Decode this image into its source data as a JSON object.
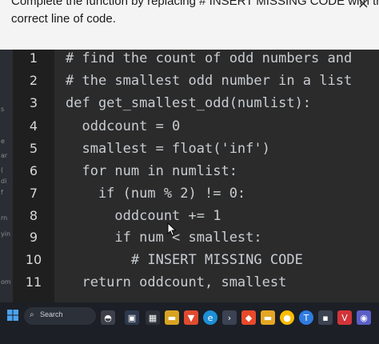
{
  "prompt": {
    "line1": "Complete the function by replacing # INSERT MISSING CODE with the",
    "line2": "correct line of code.",
    "close": "×"
  },
  "sidebar_fragments": [
    "s",
    "e",
    "ar",
    "(",
    "di",
    "f",
    "rn",
    "yin",
    "om"
  ],
  "code": {
    "lines": [
      {
        "num": "1",
        "text": "# find the count of odd numbers and"
      },
      {
        "num": "2",
        "text": "# the smallest odd number in a list"
      },
      {
        "num": "3",
        "text": "def get_smallest_odd(numlist):"
      },
      {
        "num": "4",
        "text": "  oddcount = 0"
      },
      {
        "num": "5",
        "text": "  smallest = float('inf')"
      },
      {
        "num": "6",
        "text": "  for num in numlist:"
      },
      {
        "num": "7",
        "text": "    if (num % 2) != 0:"
      },
      {
        "num": "8",
        "text": "      oddcount += 1"
      },
      {
        "num": "9",
        "text": "      if num < smallest:"
      },
      {
        "num": "10",
        "text": "        # INSERT MISSING CODE"
      },
      {
        "num": "11",
        "text": "  return oddcount, smallest"
      }
    ]
  },
  "taskbar": {
    "search_label": "Search",
    "icons": [
      "windows-start-icon",
      "search-icon",
      "copilot-icon",
      "task-view-icon",
      "widgets-icon",
      "file-explorer-icon",
      "store-icon",
      "brave-browser-icon",
      "edge-browser-icon",
      "terminal-icon",
      "app-icon",
      "chrome-browser-icon",
      "onedrive-icon",
      "firefox-icon",
      "vivaldi-icon",
      "teams-icon"
    ]
  },
  "colors": {
    "editor_bg": "#2b2b2b",
    "gutter_bg": "#1f1f1f",
    "code_text": "#c9cdd2",
    "taskbar_bg": "#1c1f26"
  }
}
